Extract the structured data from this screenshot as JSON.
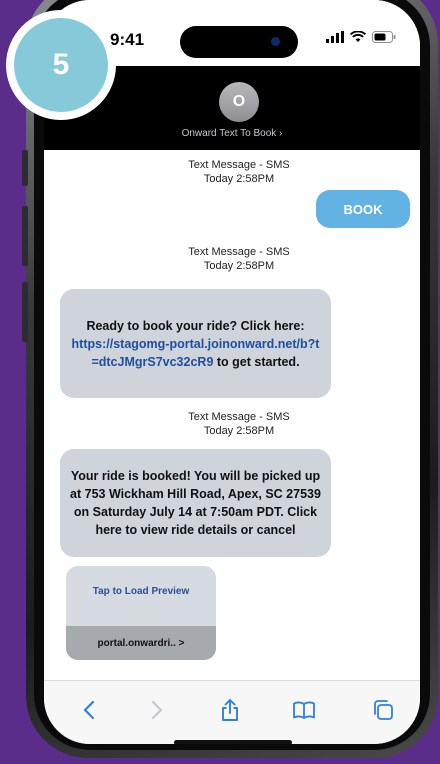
{
  "step_badge": {
    "number": "5"
  },
  "status_bar": {
    "time": "9:41"
  },
  "chat_header": {
    "avatar_letter": "O",
    "contact_name": "Onward Text To Book ›"
  },
  "messages": {
    "ts1": {
      "type": "Text Message - SMS",
      "time": "Today 2:58PM"
    },
    "outgoing": {
      "text": "BOOK"
    },
    "ts2": {
      "type": "Text Message - SMS",
      "time": "Today 2:58PM"
    },
    "incoming1": {
      "prefix": "Ready to book your ride? Click here:",
      "link": "https://stagomg-portal.joinonward.net/b?t=dtcJMgrS7vc32cR9",
      "suffix": "to get started."
    },
    "ts3": {
      "type": "Text Message - SMS",
      "time": "Today 2:58PM"
    },
    "incoming2": {
      "text": "Your ride is booked! You will be picked up at 753 Wickham Hill Road, Apex, SC 27539 on Saturday July 14 at 7:50am PDT. Click here to view ride details or cancel"
    },
    "preview": {
      "tap_label": "Tap to Load Preview",
      "domain": "portal.onwardri.. >"
    }
  },
  "toolbar": {
    "icons": [
      "back-icon",
      "forward-icon",
      "share-icon",
      "bookmarks-icon",
      "tabs-icon"
    ]
  },
  "colors": {
    "background": "#5b2d8a",
    "outgoing_bubble": "#62b2e4",
    "incoming_bubble": "#cfd3da",
    "link": "#1f4fa0",
    "badge": "#86cad9"
  }
}
